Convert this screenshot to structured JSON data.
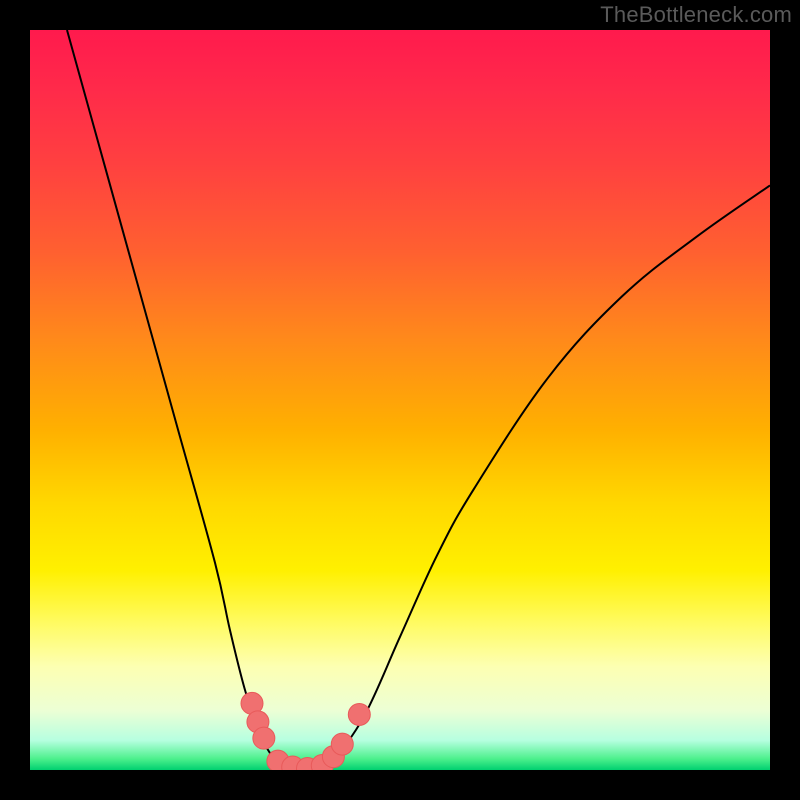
{
  "watermark": "TheBottleneck.com",
  "colors": {
    "curve": "#000000",
    "marker_fill": "#f07070",
    "marker_stroke": "#e85a5a",
    "background_black": "#000000"
  },
  "chart_data": {
    "type": "line",
    "title": "",
    "xlabel": "",
    "ylabel": "",
    "xlim": [
      0,
      100
    ],
    "ylim": [
      0,
      100
    ],
    "grid": false,
    "series": [
      {
        "name": "left-branch",
        "x": [
          5,
          10,
          15,
          20,
          25,
          27,
          29,
          31,
          33,
          35
        ],
        "y": [
          100,
          82,
          64,
          46,
          28,
          19,
          11,
          5,
          1.5,
          0
        ]
      },
      {
        "name": "right-branch",
        "x": [
          40,
          45,
          50,
          55,
          60,
          70,
          80,
          90,
          100
        ],
        "y": [
          0,
          7,
          18,
          29,
          38,
          53,
          64,
          72,
          79
        ]
      }
    ],
    "flat_bottom": {
      "x_start": 35,
      "x_end": 40,
      "y": 0
    },
    "markers": [
      {
        "x": 30.0,
        "y": 9.0
      },
      {
        "x": 30.8,
        "y": 6.5
      },
      {
        "x": 31.6,
        "y": 4.3
      },
      {
        "x": 33.5,
        "y": 1.2
      },
      {
        "x": 35.5,
        "y": 0.4
      },
      {
        "x": 37.5,
        "y": 0.2
      },
      {
        "x": 39.5,
        "y": 0.6
      },
      {
        "x": 41.0,
        "y": 1.8
      },
      {
        "x": 42.2,
        "y": 3.5
      },
      {
        "x": 44.5,
        "y": 7.5
      }
    ]
  }
}
